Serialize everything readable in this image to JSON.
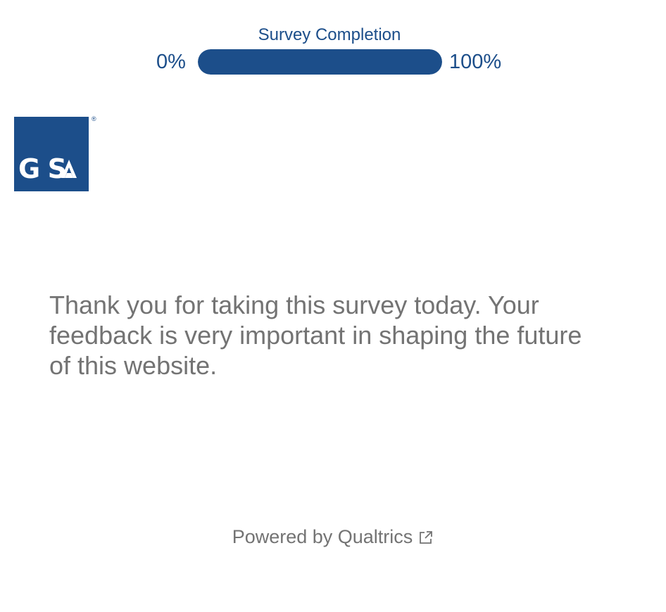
{
  "progress": {
    "title": "Survey Completion",
    "min_label": "0%",
    "max_label": "100%",
    "percent": 100,
    "color": "#1c4e8a"
  },
  "logo": {
    "text": "GSA",
    "registered_mark": "®"
  },
  "message": {
    "text": "Thank you for taking this survey today. Your feedback is very important in shaping the future of this website."
  },
  "footer": {
    "powered_by": "Powered by Qualtrics",
    "icon": "external-link-icon"
  }
}
